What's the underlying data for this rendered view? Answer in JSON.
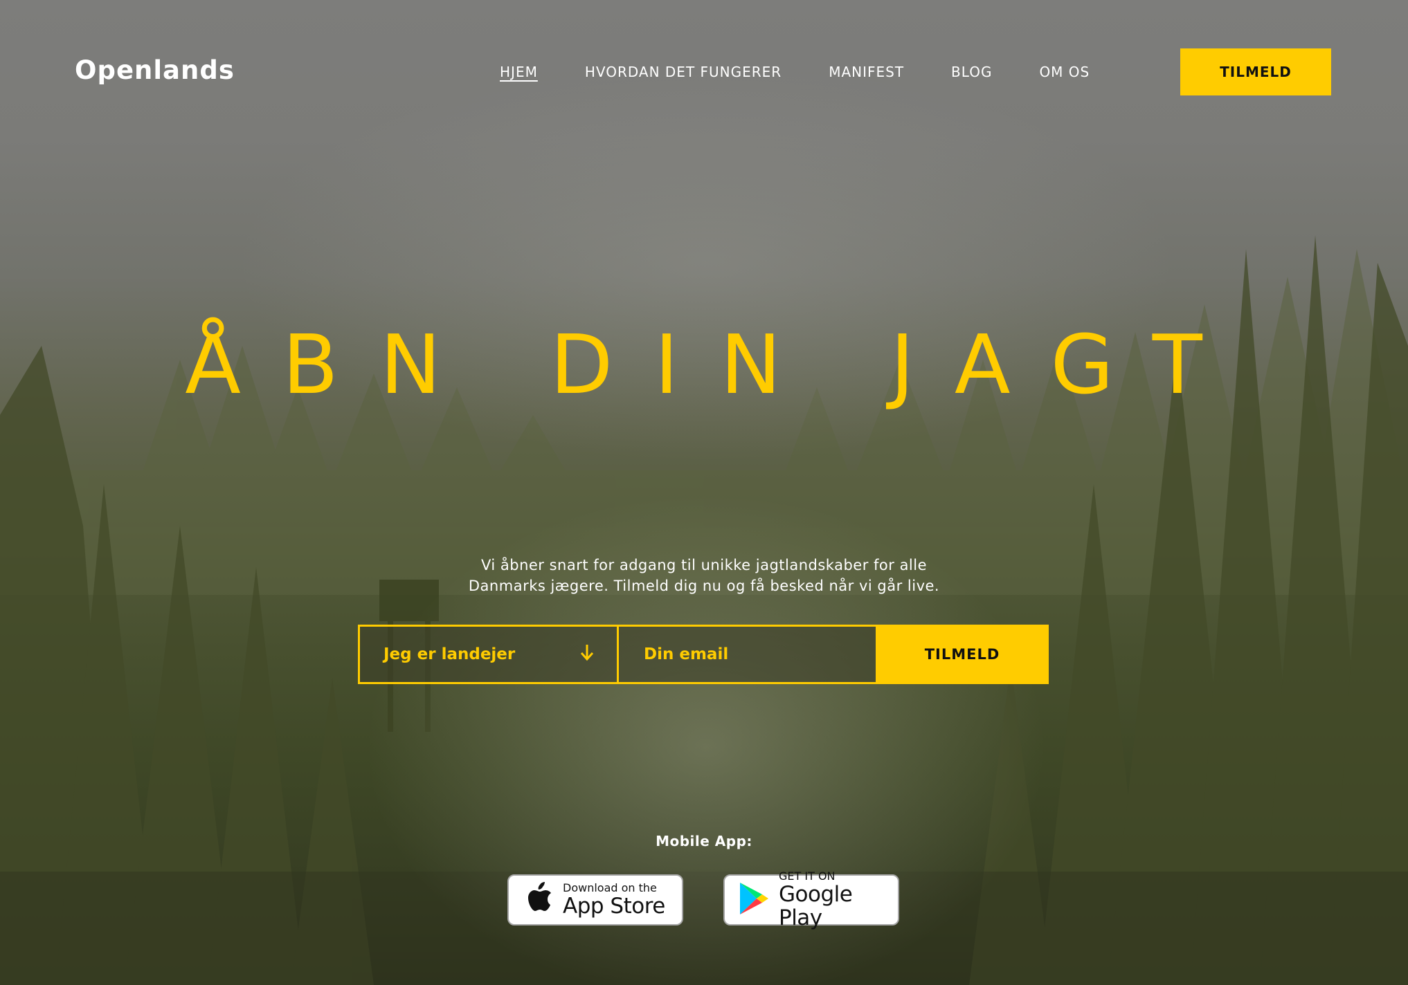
{
  "brand": {
    "logo": "Openlands"
  },
  "nav": {
    "items": [
      {
        "label": "HJEM",
        "active": true
      },
      {
        "label": "HVORDAN DET FUNGERER"
      },
      {
        "label": "MANIFEST"
      },
      {
        "label": "BLOG"
      },
      {
        "label": "OM OS"
      }
    ],
    "cta_label": "TILMELD"
  },
  "hero": {
    "title": "ÅBN DIN JAGT",
    "subtitle_line1": "Vi åbner snart for adgang til unikke jagtlandskaber for alle",
    "subtitle_line2": "Danmarks jægere. Tilmeld dig nu og få besked når vi går live."
  },
  "signup": {
    "role_selected": "Jeg er landejer",
    "role_icon": "arrow-down-icon",
    "email_placeholder": "Din email",
    "submit_label": "TILMELD"
  },
  "mobile": {
    "label": "Mobile App:",
    "app_store": {
      "small": "Download on the",
      "big": "App Store",
      "icon": "apple-icon"
    },
    "google_play": {
      "small": "GET IT ON",
      "big": "Google Play",
      "icon": "google-play-icon"
    }
  },
  "colors": {
    "accent": "#ffcc00",
    "text_light": "#ffffff",
    "text_dark": "#111111"
  }
}
